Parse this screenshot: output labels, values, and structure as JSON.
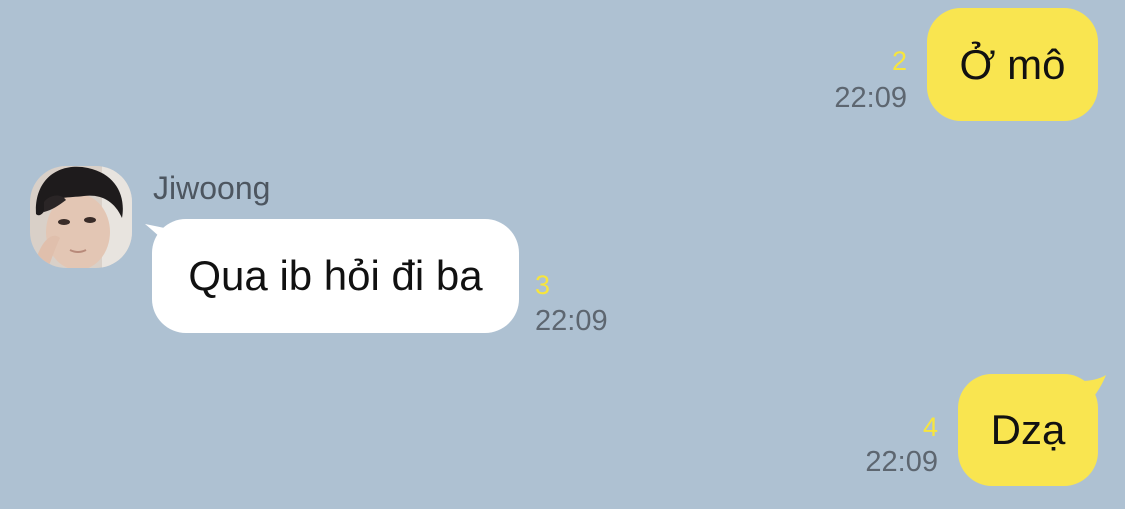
{
  "messages": [
    {
      "id": "m1",
      "direction": "outgoing",
      "text": "Ở mô",
      "unread_count": "2",
      "time": "22:09"
    },
    {
      "id": "m2",
      "direction": "incoming",
      "sender": "Jiwoong",
      "text": "Qua ib hỏi đi ba",
      "unread_count": "3",
      "time": "22:09"
    },
    {
      "id": "m3",
      "direction": "outgoing",
      "text": "Dzạ",
      "unread_count": "4",
      "time": "22:09"
    }
  ],
  "colors": {
    "background": "#aec1d2",
    "outgoing_bubble": "#f9e550",
    "incoming_bubble": "#ffffff",
    "unread_count": "#f7e53d",
    "timestamp": "#5d6670"
  }
}
